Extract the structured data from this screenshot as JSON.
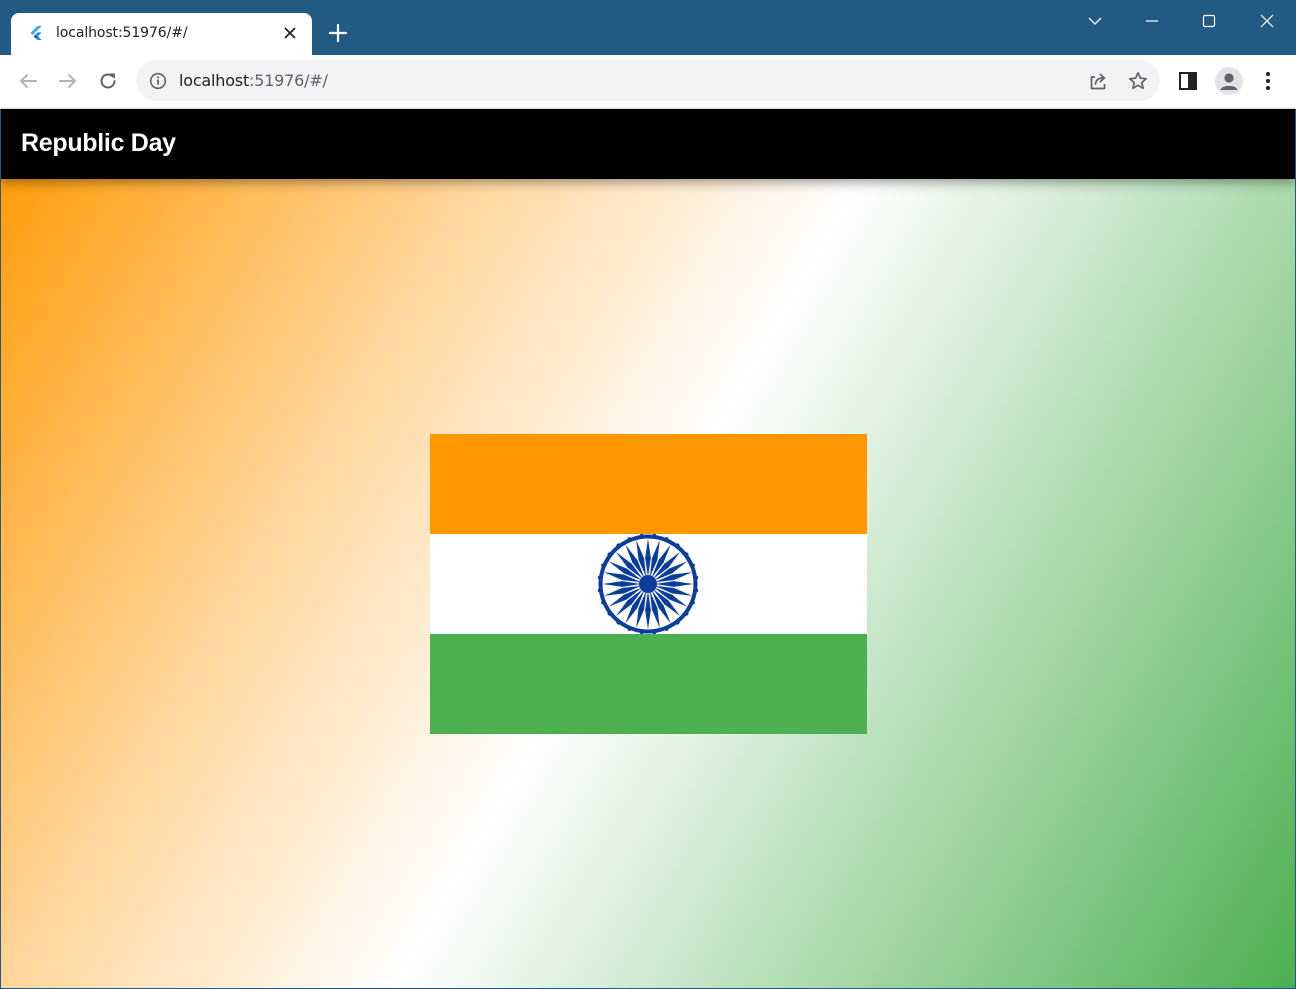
{
  "browser": {
    "tab": {
      "title": "localhost:51976/#/",
      "favicon": "flutter-icon"
    },
    "address_bar": {
      "url_host": "localhost",
      "url_rest": ":51976/#/",
      "info_icon": "info-icon"
    },
    "icons": {
      "back": "back-arrow-icon",
      "forward": "forward-arrow-icon",
      "reload": "reload-icon",
      "share": "share-icon",
      "bookmark": "star-icon",
      "side_panel": "side-panel-icon",
      "profile": "profile-avatar-icon",
      "menu": "kebab-menu-icon",
      "new_tab": "plus-icon",
      "tab_search": "chevron-down-icon",
      "minimize": "minimize-icon",
      "maximize": "maximize-icon",
      "close": "close-icon"
    },
    "colors": {
      "frame": "#235a83",
      "toolbar": "#ffffff",
      "omnibox": "#f1f3f4"
    }
  },
  "app": {
    "title": "Republic Day",
    "colors": {
      "appbar": "#000000",
      "gradient_start": "#ff9800",
      "gradient_mid": "#ffffff",
      "gradient_end": "#4caf50"
    },
    "flag": {
      "bands": [
        "saffron",
        "white",
        "green"
      ],
      "colors": {
        "saffron": "#ff9800",
        "white": "#ffffff",
        "green": "#4caf50",
        "chakra": "#0d3d9c"
      },
      "chakra_spokes": 24
    }
  }
}
